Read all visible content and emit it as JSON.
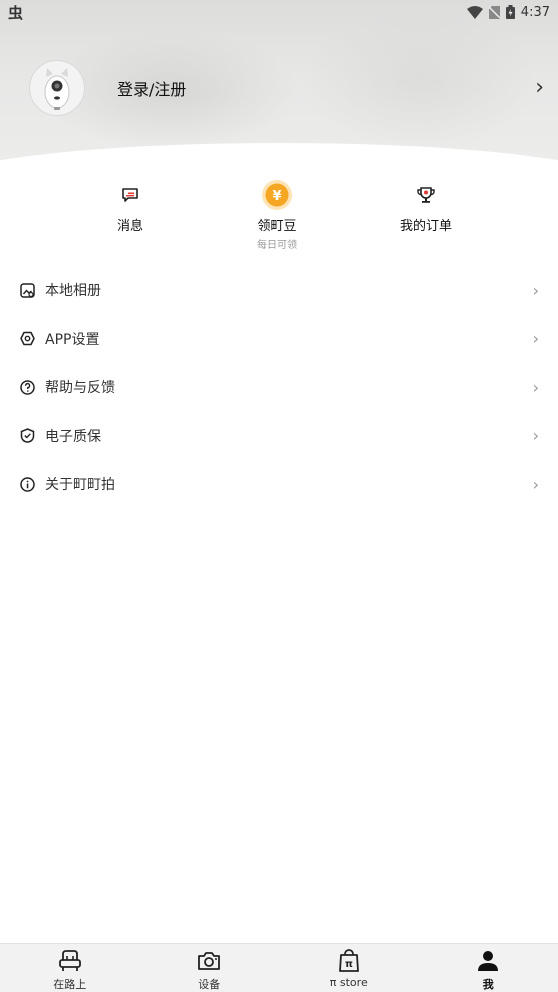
{
  "status_bar": {
    "left_icon": "app-notification-icon",
    "left_glyph": "虫",
    "right_icons": [
      "wifi-icon",
      "no-sim-icon",
      "battery-charging-icon"
    ],
    "time": "4:37"
  },
  "profile": {
    "avatar_icon": "robot-camera-avatar",
    "login_label": "登录/注册"
  },
  "quick_actions": [
    {
      "icon": "message-icon",
      "label": "消息",
      "subtext": ""
    },
    {
      "icon": "coin-icon",
      "label": "领町豆",
      "subtext": "每日可领"
    },
    {
      "icon": "trophy-icon",
      "label": "我的订单",
      "subtext": ""
    }
  ],
  "menu": {
    "items": [
      {
        "icon": "photo-album-icon",
        "label": "本地相册"
      },
      {
        "icon": "settings-icon",
        "label": "APP设置"
      },
      {
        "icon": "help-icon",
        "label": "帮助与反馈"
      },
      {
        "icon": "shield-check-icon",
        "label": "电子质保"
      },
      {
        "icon": "info-icon",
        "label": "关于町町拍"
      }
    ]
  },
  "bottom_nav": {
    "active_index": 3,
    "tabs": [
      {
        "icon": "car-seat-icon",
        "label": "在路上"
      },
      {
        "icon": "camera-icon",
        "label": "设备"
      },
      {
        "icon": "store-bag-icon",
        "label": "π store"
      },
      {
        "icon": "person-icon",
        "label": "我"
      }
    ]
  },
  "colors": {
    "coin": "#f5a623",
    "accent_red": "#e53935",
    "text_primary": "#222222",
    "text_secondary": "#999999"
  }
}
